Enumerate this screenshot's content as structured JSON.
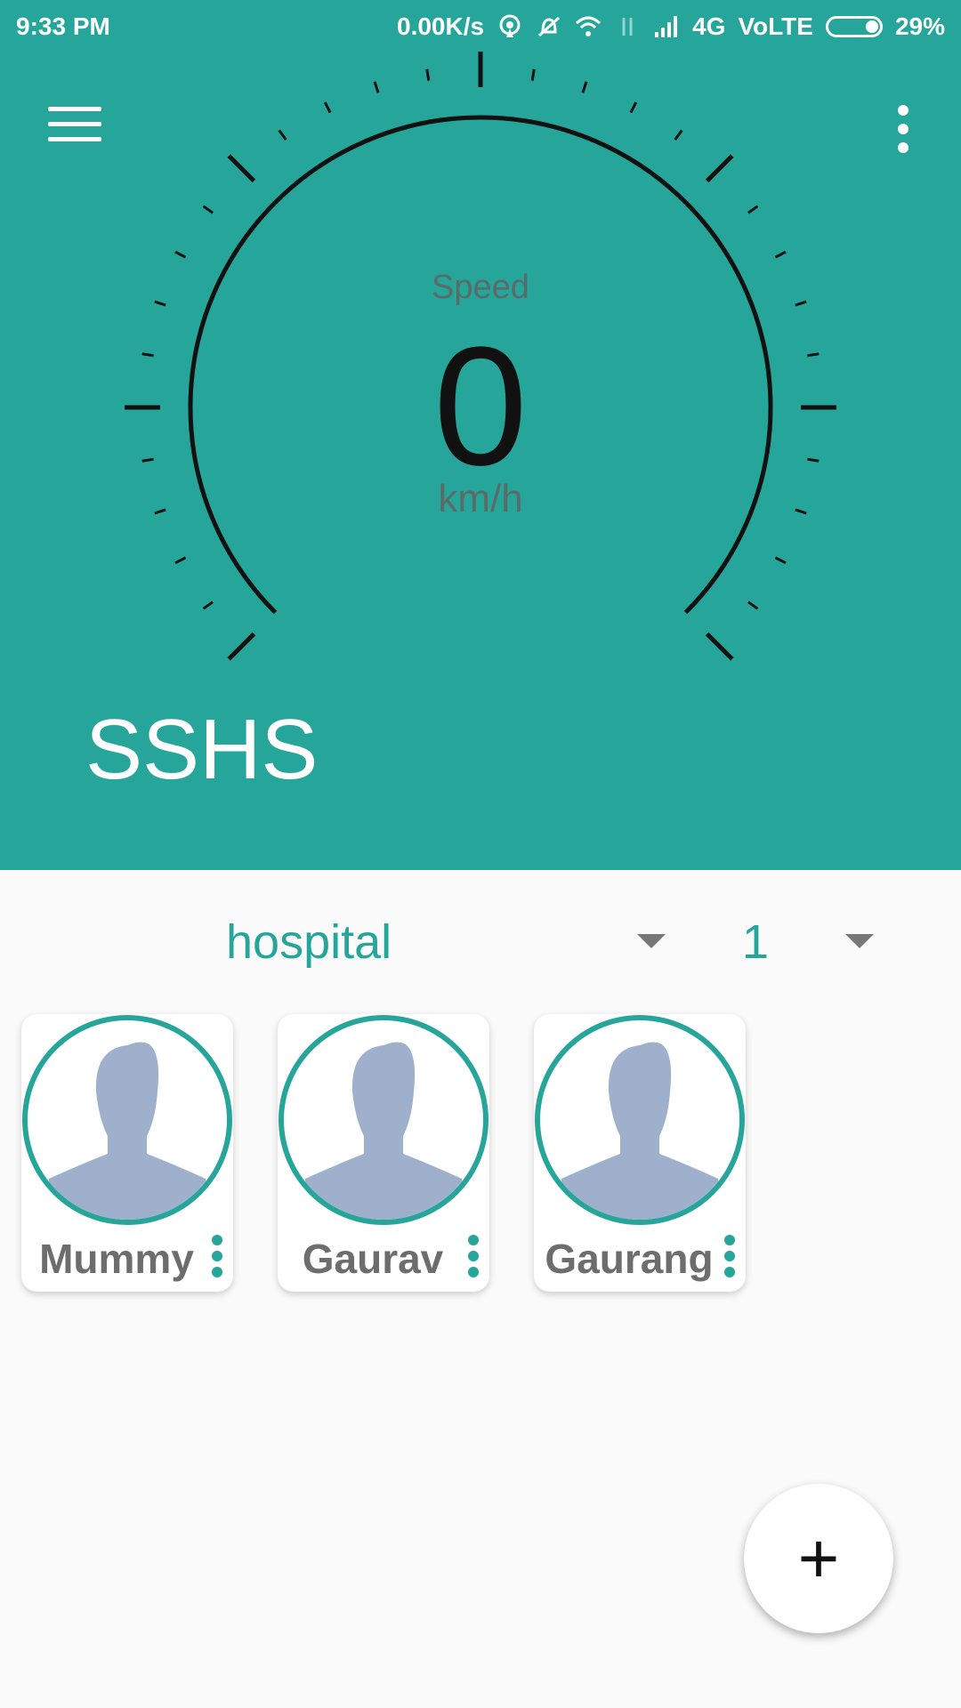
{
  "status_bar": {
    "time": "9:33 PM",
    "net_speed": "0.00K/s",
    "network": "4G",
    "volte": "VoLTE",
    "battery": "29%"
  },
  "speedometer": {
    "label": "Speed",
    "value": "0",
    "unit": "km/h"
  },
  "app": {
    "title": "SSHS"
  },
  "filters": {
    "place": "hospital",
    "count": "1"
  },
  "contacts": [
    {
      "name": "Mummy"
    },
    {
      "name": "Gaurav"
    },
    {
      "name": "Gaurang"
    }
  ],
  "fab": {
    "label": "+"
  },
  "colors": {
    "primary": "#26a69a",
    "avatar": "#9fb0cc",
    "background": "#fafafa"
  }
}
